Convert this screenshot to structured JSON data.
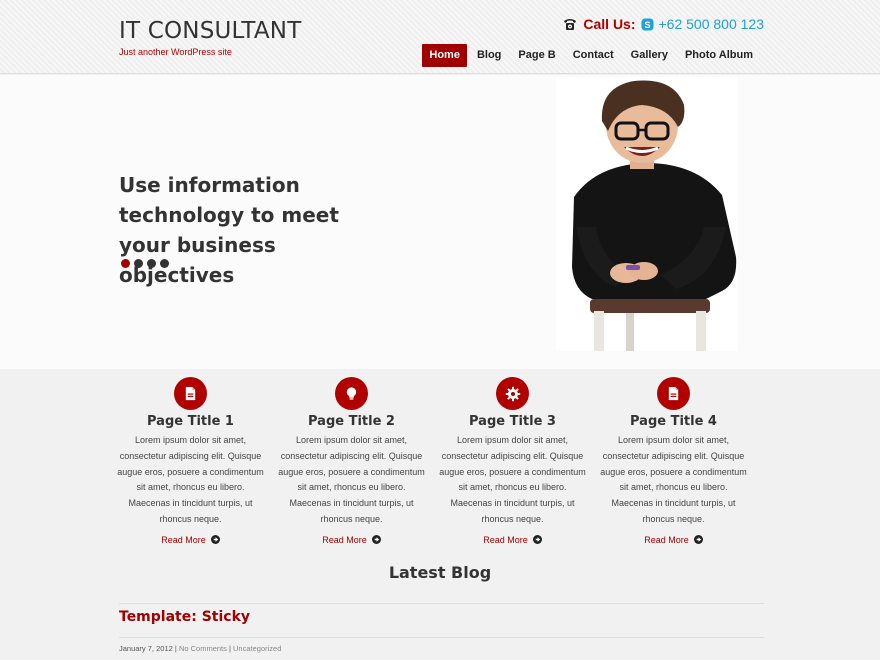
{
  "header": {
    "site_title": "IT CONSULTANT",
    "tagline": "Just another WordPress site",
    "call_label": "Call Us:",
    "phone": "+62 500 800 123",
    "icons": [
      "phone-icon",
      "skype-icon"
    ],
    "colors": {
      "accent": "#a10000",
      "phone": "#1fa0d8"
    }
  },
  "nav": {
    "items": [
      {
        "label": "Home",
        "active": true
      },
      {
        "label": "Blog"
      },
      {
        "label": "Page B"
      },
      {
        "label": "Contact"
      },
      {
        "label": "Gallery"
      },
      {
        "label": "Photo Album"
      }
    ]
  },
  "hero": {
    "headline": "Use information technology to meet your business objectives",
    "slides_total": 4,
    "active_slide": 1
  },
  "features": [
    {
      "icon": "document-icon",
      "title": "Page Title 1",
      "text": "Lorem ipsum dolor sit amet, consectetur adipiscing elit. Quisque augue eros, posuere a condimentum sit amet, rhoncus eu libero. Maecenas in tincidunt turpis, ut rhoncus neque.",
      "more": "Read More"
    },
    {
      "icon": "lightbulb-icon",
      "title": "Page Title 2",
      "text": "Lorem ipsum dolor sit amet, consectetur adipiscing elit. Quisque augue eros, posuere a condimentum sit amet, rhoncus eu libero. Maecenas in tincidunt turpis, ut rhoncus neque.",
      "more": "Read More"
    },
    {
      "icon": "gear-icon",
      "title": "Page Title 3",
      "text": "Lorem ipsum dolor sit amet, consectetur adipiscing elit. Quisque augue eros, posuere a condimentum sit amet, rhoncus eu libero. Maecenas in tincidunt turpis, ut rhoncus neque.",
      "more": "Read More"
    },
    {
      "icon": "document-icon",
      "title": "Page Title 4",
      "text": "Lorem ipsum dolor sit amet, consectetur adipiscing elit. Quisque augue eros, posuere a condimentum sit amet, rhoncus eu libero. Maecenas in tincidunt turpis, ut rhoncus neque.",
      "more": "Read More"
    }
  ],
  "blog": {
    "heading": "Latest Blog",
    "post_title": "Template: Sticky",
    "post_date": "January 7, 2012",
    "post_comments": "No Comments",
    "post_category": "Uncategorized",
    "separator": "|"
  }
}
